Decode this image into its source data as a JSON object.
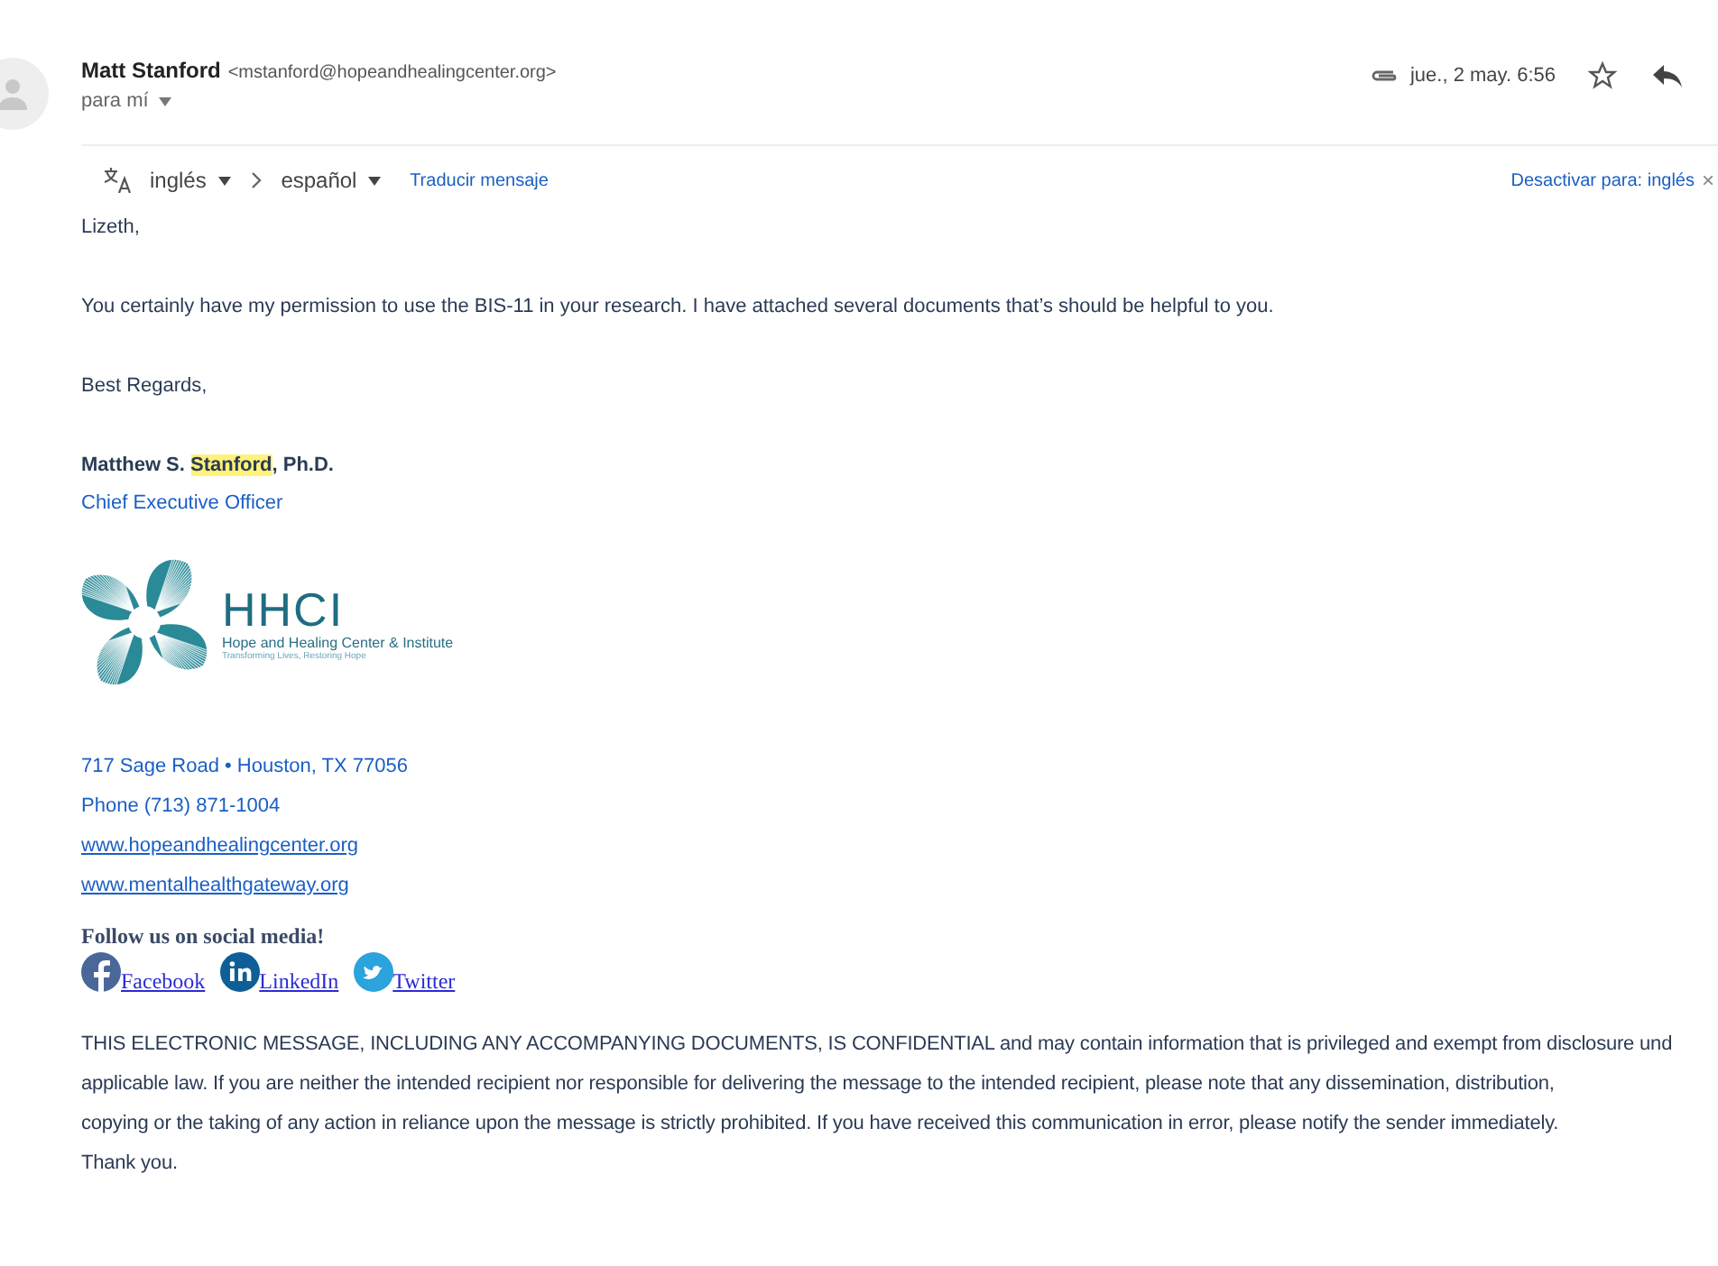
{
  "header": {
    "sender_name": "Matt Stanford",
    "sender_email": "<mstanford@hopeandhealingcenter.org>",
    "recipient": "para mí",
    "has_attachment": true,
    "date": "jue., 2 may. 6:56",
    "starred": false
  },
  "translate_bar": {
    "from": "inglés",
    "to": "español",
    "translate_link": "Traducir mensaje",
    "disable_link": "Desactivar para: inglés",
    "close": "×"
  },
  "body": {
    "greeting": "Lizeth,",
    "paragraph": "You certainly have my permission to use the BIS-11 in your research. I have attached several documents that’s should be helpful to you.",
    "closing": "Best Regards,"
  },
  "signature": {
    "name_parts": [
      {
        "text": "Matthew S. ",
        "highlighted": false
      },
      {
        "text": "Stanford",
        "highlighted": true
      },
      {
        "text": ", Ph.D.",
        "highlighted": false
      }
    ],
    "title": "Chief Executive Officer",
    "logo": {
      "initials": "HHCI",
      "name": "Hope and Healing Center & Institute",
      "tagline": "Transforming Lives, Restoring Hope"
    },
    "address": "717 Sage Road • Houston, TX 77056",
    "phone": "Phone (713) 871-1004",
    "links": [
      "www.hopeandhealingcenter.org",
      "www.mentalhealthgateway.org"
    ],
    "social_heading": "Follow us on social media!",
    "social": [
      {
        "kind": "facebook",
        "label": "Facebook"
      },
      {
        "kind": "linkedin",
        "label": "LinkedIn"
      },
      {
        "kind": "twitter",
        "label": "Twitter"
      }
    ]
  },
  "disclaimer_lines": [
    "THIS ELECTRONIC MESSAGE, INCLUDING ANY ACCOMPANYING DOCUMENTS, IS CONFIDENTIAL and may contain information that is privileged and exempt from disclosure und",
    "applicable law. If you are neither the intended recipient nor responsible for delivering the message to the intended recipient, please note that any dissemination, distribution,",
    "copying or the taking of any action in reliance upon the message is strictly prohibited. If you have received this communication in error, please notify the sender immediately.",
    "Thank you."
  ]
}
